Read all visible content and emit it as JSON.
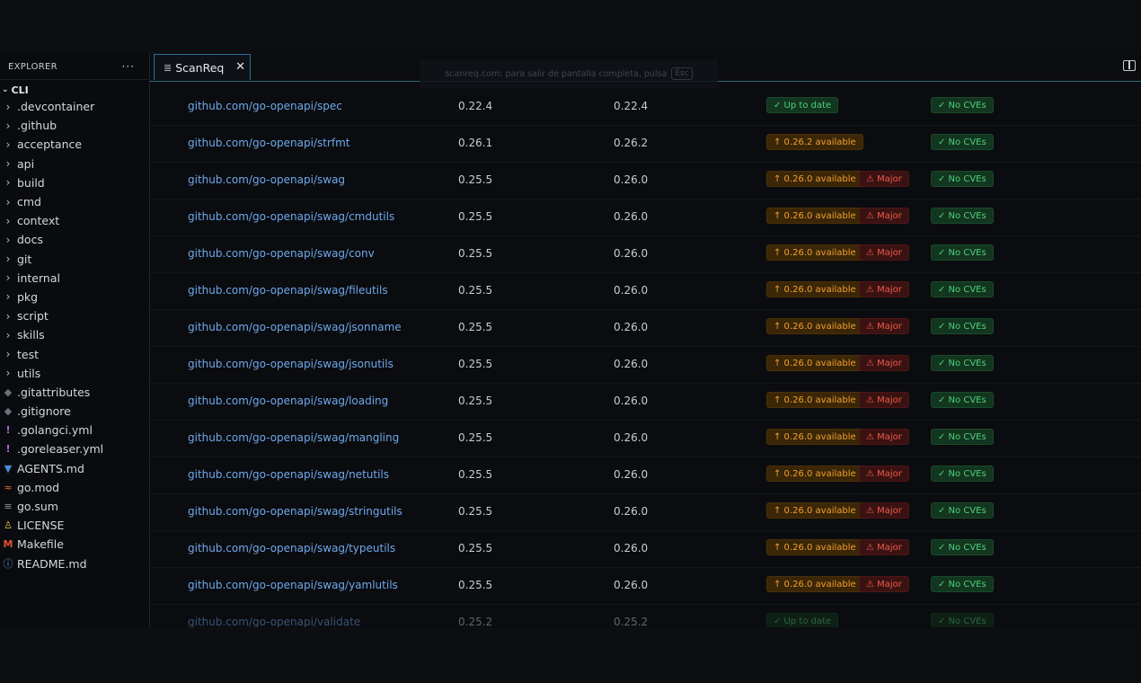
{
  "explorer": {
    "title": "EXPLORER",
    "more": "···",
    "root": "CLI",
    "items": [
      {
        "label": ".devcontainer",
        "type": "folder",
        "icon": "chevron-right-icon"
      },
      {
        "label": ".github",
        "type": "folder",
        "icon": "chevron-right-icon"
      },
      {
        "label": "acceptance",
        "type": "folder",
        "icon": "chevron-right-icon"
      },
      {
        "label": "api",
        "type": "folder",
        "icon": "chevron-right-icon"
      },
      {
        "label": "build",
        "type": "folder",
        "icon": "chevron-right-icon"
      },
      {
        "label": "cmd",
        "type": "folder",
        "icon": "chevron-right-icon"
      },
      {
        "label": "context",
        "type": "folder",
        "icon": "chevron-right-icon"
      },
      {
        "label": "docs",
        "type": "folder",
        "icon": "chevron-right-icon"
      },
      {
        "label": "git",
        "type": "folder",
        "icon": "chevron-right-icon"
      },
      {
        "label": "internal",
        "type": "folder",
        "icon": "chevron-right-icon"
      },
      {
        "label": "pkg",
        "type": "folder",
        "icon": "chevron-right-icon"
      },
      {
        "label": "script",
        "type": "folder",
        "icon": "chevron-right-icon"
      },
      {
        "label": "skills",
        "type": "folder",
        "icon": "chevron-right-icon"
      },
      {
        "label": "test",
        "type": "folder",
        "icon": "chevron-right-icon"
      },
      {
        "label": "utils",
        "type": "folder",
        "icon": "chevron-right-icon"
      },
      {
        "label": ".gitattributes",
        "type": "file",
        "icon": "git-file-icon"
      },
      {
        "label": ".gitignore",
        "type": "file",
        "icon": "git-file-icon"
      },
      {
        "label": ".golangci.yml",
        "type": "file",
        "icon": "yaml-file-icon"
      },
      {
        "label": ".goreleaser.yml",
        "type": "file",
        "icon": "yaml-file-icon"
      },
      {
        "label": "AGENTS.md",
        "type": "file",
        "icon": "markdown-file-icon"
      },
      {
        "label": "go.mod",
        "type": "file",
        "icon": "go-mod-file-icon"
      },
      {
        "label": "go.sum",
        "type": "file",
        "icon": "go-sum-file-icon"
      },
      {
        "label": "LICENSE",
        "type": "file",
        "icon": "license-file-icon"
      },
      {
        "label": "Makefile",
        "type": "file",
        "icon": "makefile-icon"
      },
      {
        "label": "README.md",
        "type": "file",
        "icon": "info-file-icon"
      }
    ]
  },
  "tab": {
    "label": "ScanReq",
    "icon": "document-lines-icon",
    "close": "✕"
  },
  "toast": {
    "text": "scanreq.com: para salir de pantalla completa, pulsa",
    "key": "Esc"
  },
  "colors": {
    "link": "#6ea8ec",
    "ok": "#4fcf7a",
    "update": "#f0a030",
    "major": "#ef5a4a",
    "accent": "#2f6f7a"
  },
  "table": {
    "rows": [
      {
        "pkg": "github.com/go-openapi/spec",
        "current": "0.22.4",
        "latest": "0.22.4",
        "status": "✓ Up to date",
        "status_type": "ok",
        "major": "",
        "cves": "✓ No CVEs"
      },
      {
        "pkg": "github.com/go-openapi/strfmt",
        "current": "0.26.1",
        "latest": "0.26.2",
        "status": "↑ 0.26.2 available",
        "status_type": "update",
        "major": "",
        "cves": "✓ No CVEs"
      },
      {
        "pkg": "github.com/go-openapi/swag",
        "current": "0.25.5",
        "latest": "0.26.0",
        "status": "↑ 0.26.0 available",
        "status_type": "update",
        "major": "⚠ Major",
        "cves": "✓ No CVEs"
      },
      {
        "pkg": "github.com/go-openapi/swag/cmdutils",
        "current": "0.25.5",
        "latest": "0.26.0",
        "status": "↑ 0.26.0 available",
        "status_type": "update",
        "major": "⚠ Major",
        "cves": "✓ No CVEs"
      },
      {
        "pkg": "github.com/go-openapi/swag/conv",
        "current": "0.25.5",
        "latest": "0.26.0",
        "status": "↑ 0.26.0 available",
        "status_type": "update",
        "major": "⚠ Major",
        "cves": "✓ No CVEs"
      },
      {
        "pkg": "github.com/go-openapi/swag/fileutils",
        "current": "0.25.5",
        "latest": "0.26.0",
        "status": "↑ 0.26.0 available",
        "status_type": "update",
        "major": "⚠ Major",
        "cves": "✓ No CVEs"
      },
      {
        "pkg": "github.com/go-openapi/swag/jsonname",
        "current": "0.25.5",
        "latest": "0.26.0",
        "status": "↑ 0.26.0 available",
        "status_type": "update",
        "major": "⚠ Major",
        "cves": "✓ No CVEs"
      },
      {
        "pkg": "github.com/go-openapi/swag/jsonutils",
        "current": "0.25.5",
        "latest": "0.26.0",
        "status": "↑ 0.26.0 available",
        "status_type": "update",
        "major": "⚠ Major",
        "cves": "✓ No CVEs"
      },
      {
        "pkg": "github.com/go-openapi/swag/loading",
        "current": "0.25.5",
        "latest": "0.26.0",
        "status": "↑ 0.26.0 available",
        "status_type": "update",
        "major": "⚠ Major",
        "cves": "✓ No CVEs"
      },
      {
        "pkg": "github.com/go-openapi/swag/mangling",
        "current": "0.25.5",
        "latest": "0.26.0",
        "status": "↑ 0.26.0 available",
        "status_type": "update",
        "major": "⚠ Major",
        "cves": "✓ No CVEs"
      },
      {
        "pkg": "github.com/go-openapi/swag/netutils",
        "current": "0.25.5",
        "latest": "0.26.0",
        "status": "↑ 0.26.0 available",
        "status_type": "update",
        "major": "⚠ Major",
        "cves": "✓ No CVEs"
      },
      {
        "pkg": "github.com/go-openapi/swag/stringutils",
        "current": "0.25.5",
        "latest": "0.26.0",
        "status": "↑ 0.26.0 available",
        "status_type": "update",
        "major": "⚠ Major",
        "cves": "✓ No CVEs"
      },
      {
        "pkg": "github.com/go-openapi/swag/typeutils",
        "current": "0.25.5",
        "latest": "0.26.0",
        "status": "↑ 0.26.0 available",
        "status_type": "update",
        "major": "⚠ Major",
        "cves": "✓ No CVEs"
      },
      {
        "pkg": "github.com/go-openapi/swag/yamlutils",
        "current": "0.25.5",
        "latest": "0.26.0",
        "status": "↑ 0.26.0 available",
        "status_type": "update",
        "major": "⚠ Major",
        "cves": "✓ No CVEs"
      },
      {
        "pkg": "github.com/go-openapi/validate",
        "current": "0.25.2",
        "latest": "0.25.2",
        "status": "✓ Up to date",
        "status_type": "ok",
        "major": "",
        "cves": "✓ No CVEs"
      }
    ]
  }
}
